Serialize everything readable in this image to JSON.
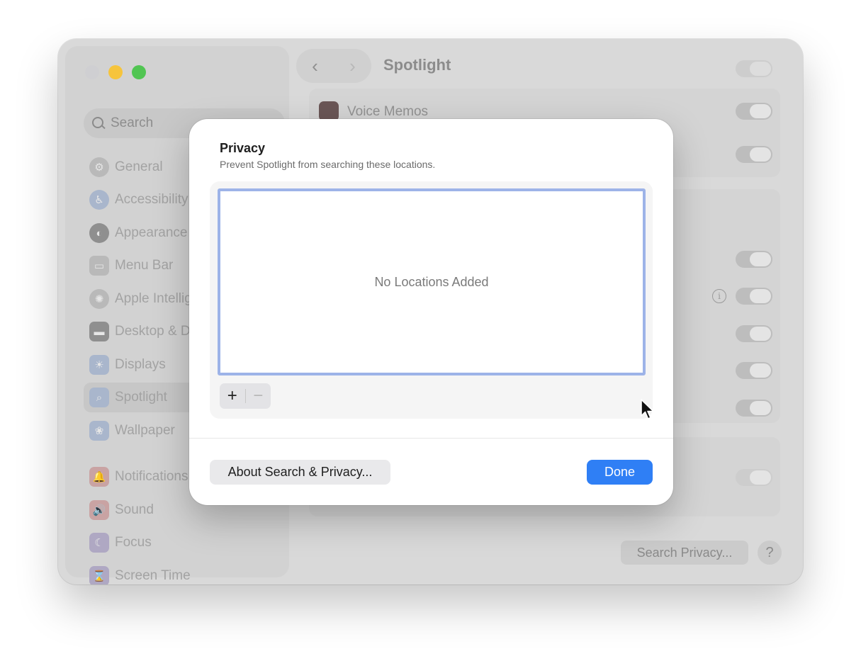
{
  "window": {
    "search_placeholder": "Search",
    "sidebar_items": [
      {
        "label": "General",
        "icon": "gear-icon",
        "glyph": "⚙"
      },
      {
        "label": "Accessibility",
        "icon": "accessibility-icon",
        "glyph": "♿"
      },
      {
        "label": "Appearance",
        "icon": "appearance-icon",
        "glyph": "◐"
      },
      {
        "label": "Menu Bar",
        "icon": "menu-bar-icon",
        "glyph": "▭"
      },
      {
        "label": "Apple Intellig",
        "icon": "apple-intelligence-icon",
        "glyph": "✺"
      },
      {
        "label": "Desktop & Do",
        "icon": "desktop-dock-icon",
        "glyph": "▬"
      },
      {
        "label": "Displays",
        "icon": "displays-icon",
        "glyph": "☀"
      },
      {
        "label": "Spotlight",
        "icon": "spotlight-icon",
        "glyph": "⌕"
      },
      {
        "label": "Wallpaper",
        "icon": "wallpaper-icon",
        "glyph": "❀"
      },
      {
        "label": "Notifications",
        "icon": "notifications-icon",
        "glyph": "🔔"
      },
      {
        "label": "Sound",
        "icon": "sound-icon",
        "glyph": "🔊"
      },
      {
        "label": "Focus",
        "icon": "focus-icon",
        "glyph": "☾"
      },
      {
        "label": "Screen Time",
        "icon": "screen-time-icon",
        "glyph": "⌛"
      }
    ],
    "selected_item": "Spotlight",
    "nav_back": "‹",
    "nav_forward": "›",
    "title": "Spotlight",
    "voice_memos_label": "Voice Memos",
    "search_privacy_button": "Search Privacy...",
    "help_button": "?",
    "info_glyph": "i"
  },
  "dialog": {
    "title": "Privacy",
    "subtitle": "Prevent Spotlight from searching these locations.",
    "empty_state": "No Locations Added",
    "add_glyph": "+",
    "remove_glyph": "−",
    "about_button": "About Search & Privacy...",
    "done_button": "Done"
  },
  "colors": {
    "accent": "#2f7ff5",
    "list_focus_ring": "#9db3e8"
  }
}
